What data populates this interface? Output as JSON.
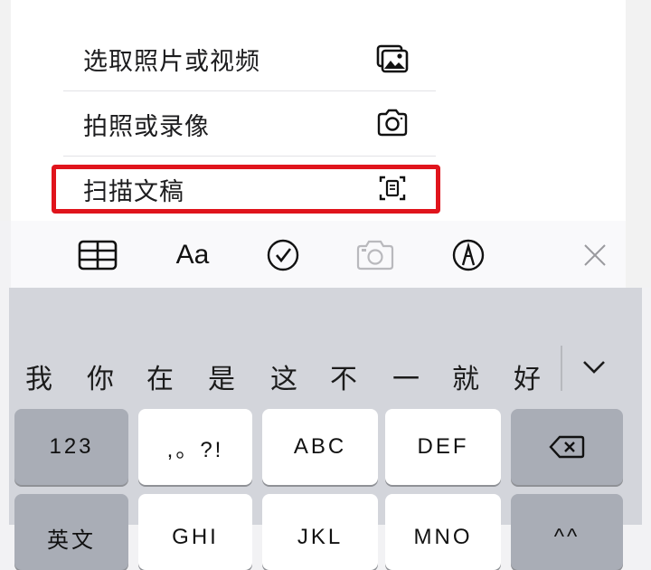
{
  "menu": {
    "items": [
      {
        "label": "选取照片或视频",
        "icon": "photo-library-icon"
      },
      {
        "label": "拍照或录像",
        "icon": "camera-icon"
      },
      {
        "label": "扫描文稿",
        "icon": "document-scan-icon"
      }
    ]
  },
  "toolbar": {
    "table_icon": "table-icon",
    "format_label": "Aa",
    "checklist_icon": "checkmark-circle-icon",
    "camera_icon": "camera-icon",
    "markup_icon": "markup-pen-icon",
    "close_icon": "close-icon"
  },
  "keyboard": {
    "candidates": [
      "我",
      "你",
      "在",
      "是",
      "这",
      "不",
      "一",
      "就",
      "好"
    ],
    "expand_icon": "chevron-down-icon",
    "row1": {
      "numbers": "123",
      "punct": ",。?!",
      "abc": "ABC",
      "def": "DEF",
      "delete_icon": "backspace-icon"
    },
    "row2": {
      "lang": "英文",
      "ghi": "GHI",
      "jkl": "JKL",
      "mno": "MNO",
      "aa": "^^"
    }
  },
  "colors": {
    "highlight": "#e0141c",
    "keyboard_bg": "#d3d5db",
    "dark_key": "#a9adb6"
  }
}
